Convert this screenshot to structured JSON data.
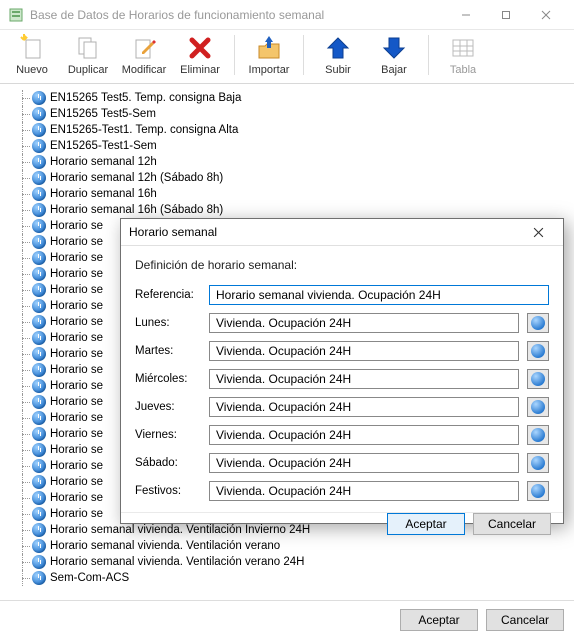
{
  "window": {
    "title": "Base de Datos de Horarios de funcionamiento semanal"
  },
  "toolbar": {
    "nuevo": "Nuevo",
    "duplicar": "Duplicar",
    "modificar": "Modificar",
    "eliminar": "Eliminar",
    "importar": "Importar",
    "subir": "Subir",
    "bajar": "Bajar",
    "tabla": "Tabla"
  },
  "tree": [
    "EN15265 Test5. Temp. consigna Baja",
    "EN15265 Test5-Sem",
    "EN15265-Test1. Temp. consigna Alta",
    "EN15265-Test1-Sem",
    "Horario semanal 12h",
    "Horario semanal 12h (Sábado 8h)",
    "Horario semanal 16h",
    "Horario semanal 16h (Sábado 8h)",
    "Horario se",
    "Horario se",
    "Horario se",
    "Horario se",
    "Horario se",
    "Horario se",
    "Horario se",
    "Horario se",
    "Horario se",
    "Horario se",
    "Horario se",
    "Horario se",
    "Horario se",
    "Horario se",
    "Horario se",
    "Horario se",
    "Horario se",
    "Horario se",
    "Horario se",
    "Horario semanal vivienda. Ventilación Invierno 24H",
    "Horario semanal vivienda. Ventilación verano",
    "Horario semanal vivienda. Ventilación verano 24H",
    "Sem-Com-ACS"
  ],
  "dialog": {
    "title": "Horario semanal",
    "heading": "Definición de horario semanal:",
    "ref_label": "Referencia:",
    "ref_value": "Horario semanal vivienda. Ocupación 24H",
    "days": [
      {
        "label": "Lunes:",
        "value": "Vivienda. Ocupación 24H"
      },
      {
        "label": "Martes:",
        "value": "Vivienda. Ocupación 24H"
      },
      {
        "label": "Miércoles:",
        "value": "Vivienda. Ocupación 24H"
      },
      {
        "label": "Jueves:",
        "value": "Vivienda. Ocupación 24H"
      },
      {
        "label": "Viernes:",
        "value": "Vivienda. Ocupación 24H"
      },
      {
        "label": "Sábado:",
        "value": "Vivienda. Ocupación 24H"
      },
      {
        "label": "Festivos:",
        "value": "Vivienda. Ocupación 24H"
      }
    ],
    "accept": "Aceptar",
    "cancel": "Cancelar"
  },
  "bottom": {
    "accept": "Aceptar",
    "cancel": "Cancelar"
  }
}
